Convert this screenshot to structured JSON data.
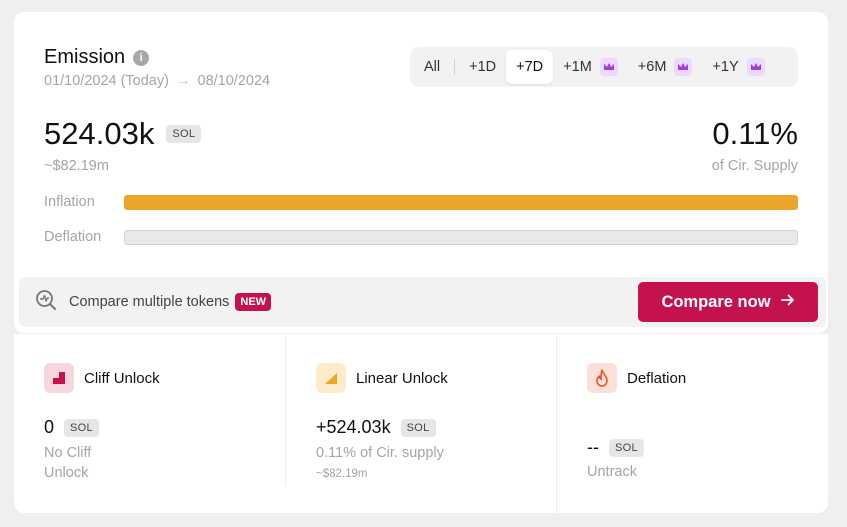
{
  "header": {
    "title": "Emission",
    "date_from": "01/10/2024 (Today)",
    "date_arrow": "→",
    "date_to": "08/10/2024"
  },
  "tabs": [
    {
      "label": "All",
      "premium": false,
      "active": false
    },
    {
      "label": "+1D",
      "premium": false,
      "active": false
    },
    {
      "label": "+7D",
      "premium": false,
      "active": true
    },
    {
      "label": "+1M",
      "premium": true,
      "active": false
    },
    {
      "label": "+6M",
      "premium": true,
      "active": false
    },
    {
      "label": "+1Y",
      "premium": true,
      "active": false
    }
  ],
  "summary": {
    "amount": "524.03k",
    "unit": "SOL",
    "usd": "~$82.19m",
    "percent": "0.11%",
    "percent_label": "of Cir. Supply"
  },
  "bars": {
    "inflation_label": "Inflation",
    "inflation_fraction": 1.0,
    "deflation_label": "Deflation",
    "deflation_fraction": 0.0
  },
  "compare": {
    "text": "Compare multiple tokens",
    "badge": "NEW",
    "button_label": "Compare now"
  },
  "breakdown": {
    "cliff": {
      "title": "Cliff Unlock",
      "value": "0",
      "unit": "SOL",
      "sub_line1": "No Cliff",
      "sub_line2": "Unlock"
    },
    "linear": {
      "title": "Linear Unlock",
      "value": "+524.03k",
      "unit": "SOL",
      "sub": "0.11% of Cir. supply",
      "usd": "~$82.19m"
    },
    "deflation": {
      "title": "Deflation",
      "value": "--",
      "unit": "SOL",
      "sub": "Untrack"
    }
  },
  "colors": {
    "accent": "#c4124e",
    "inflation": "#e9a62b",
    "premium_bg": "#ecd9fb",
    "premium_icon": "#a23ce0"
  }
}
